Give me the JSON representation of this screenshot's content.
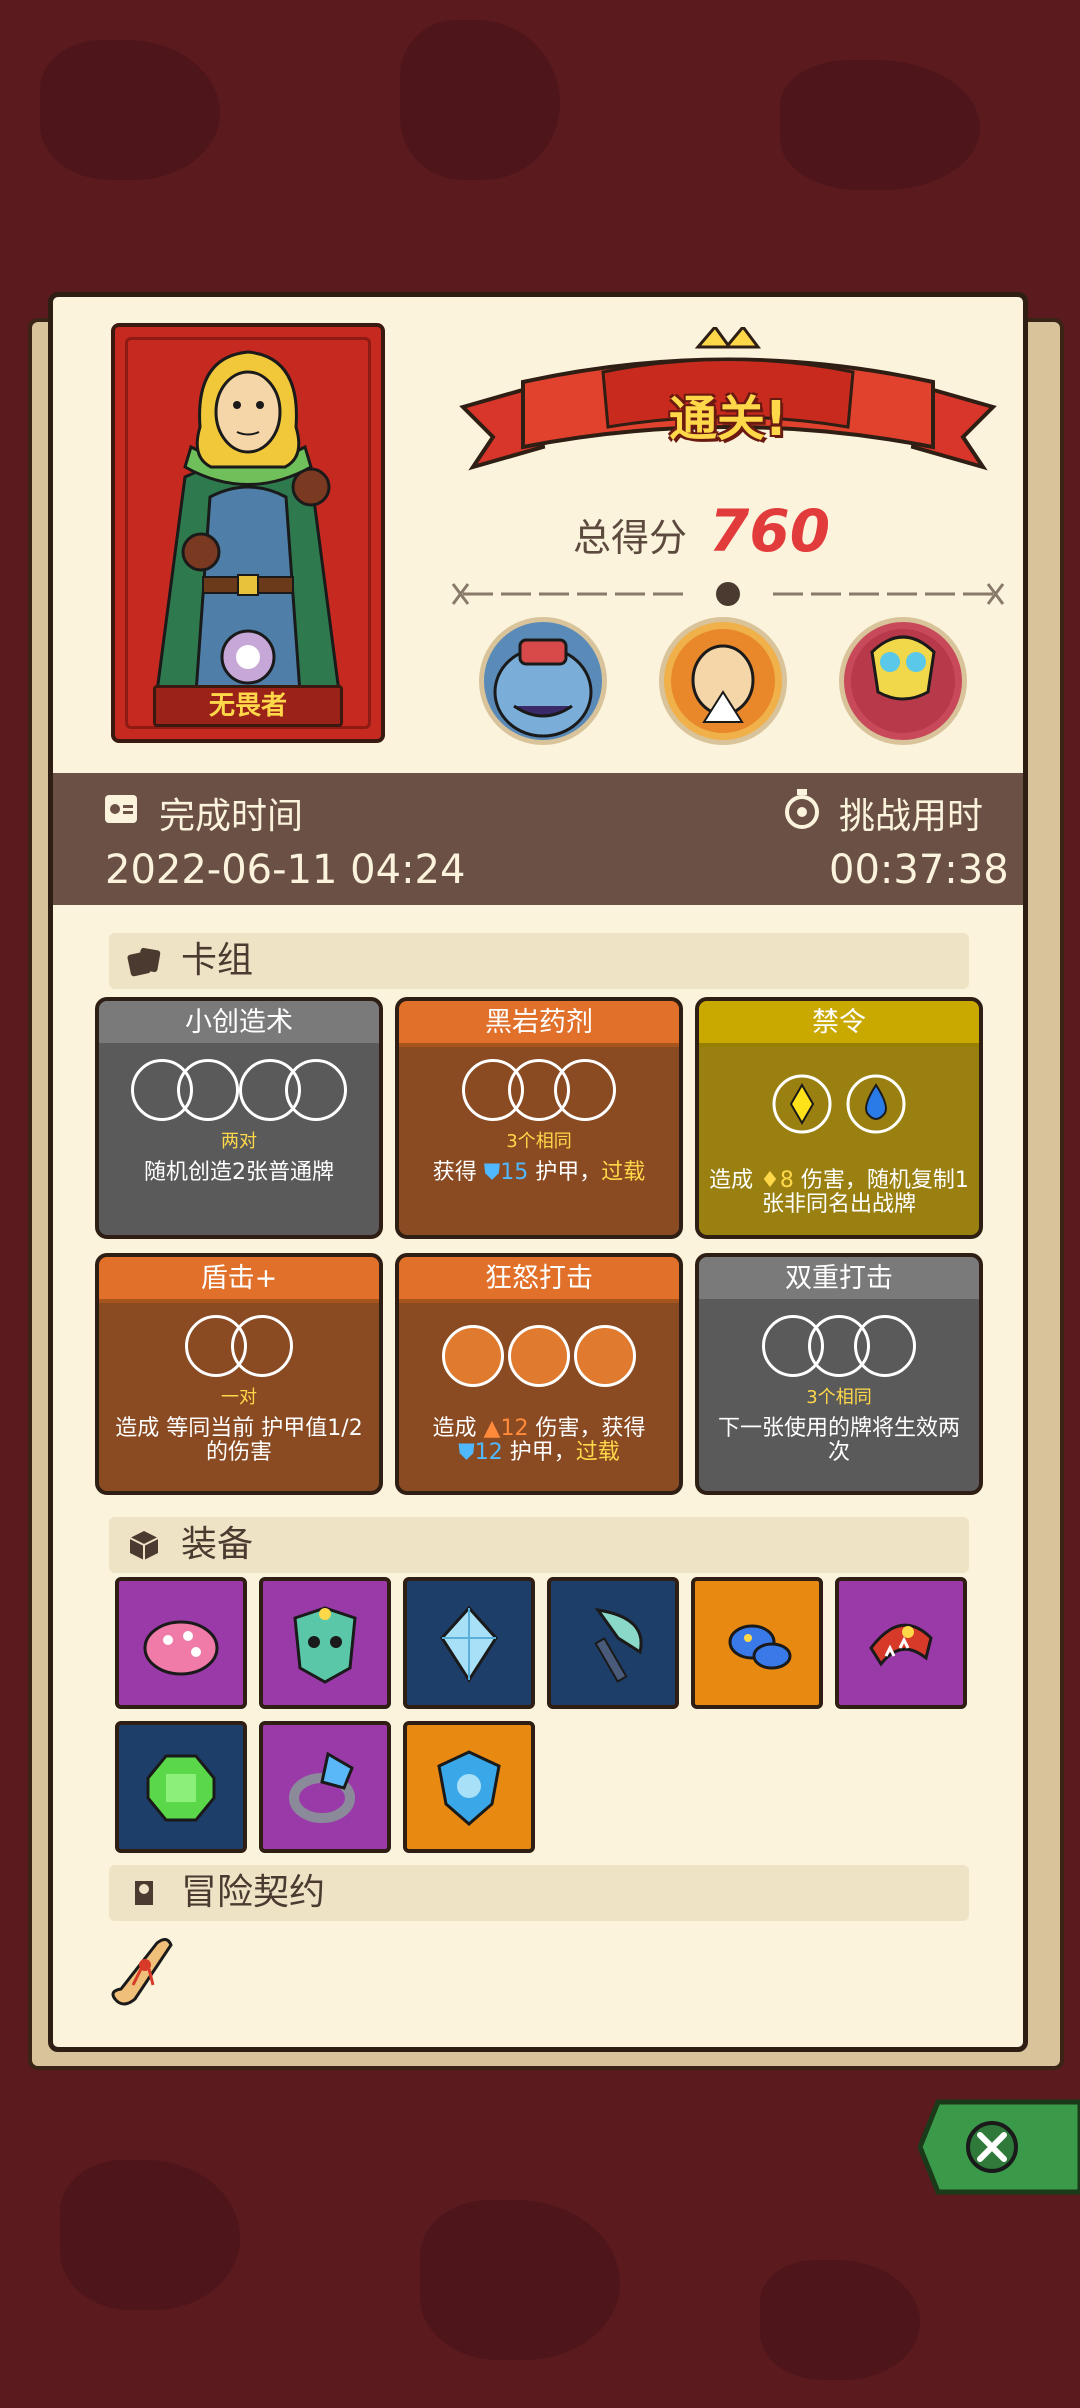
{
  "result": {
    "banner": "通关!",
    "score_label": "总得分",
    "score_value": "760"
  },
  "hero": {
    "name": "无畏者"
  },
  "time": {
    "complete_label": "完成时间",
    "complete_value": "2022-06-11 04:24",
    "challenge_label": "挑战用时",
    "challenge_value": "00:37:38"
  },
  "deck": {
    "header": "卡组",
    "cards": [
      {
        "title": "小创造术",
        "condition": "两对",
        "desc": "随机创造2张普通牌",
        "color": "gray"
      },
      {
        "title": "黑岩药剂",
        "condition": "3个相同",
        "desc_a": "获得 ",
        "num": "15",
        "desc_b": " 护甲，",
        "tag": "过载",
        "color": "brown"
      },
      {
        "title": "禁令",
        "desc_a": "造成 ",
        "num": "8",
        "desc_b": " 伤害，随机复制1张非同名出战牌",
        "color": "olive"
      },
      {
        "title": "盾击+",
        "condition": "一对",
        "desc": "造成 等同当前 护甲值1/2的伤害",
        "color": "brown"
      },
      {
        "title": "狂怒打击",
        "desc_a": "造成 ",
        "num1": "12",
        "desc_b": " 伤害，获得 ",
        "num2": "12",
        "desc_c": " 护甲，",
        "tag": "过载",
        "color": "brown"
      },
      {
        "title": "双重打击",
        "condition": "3个相同",
        "desc": "下一张使用的牌将生效两次",
        "color": "gray"
      }
    ]
  },
  "equipment": {
    "header": "装备",
    "items": [
      {
        "icon": "mushroom-icon",
        "bg": "purple"
      },
      {
        "icon": "demon-mask-icon",
        "bg": "purple"
      },
      {
        "icon": "crystal-gem-icon",
        "bg": "navy"
      },
      {
        "icon": "axe-icon",
        "bg": "navy"
      },
      {
        "icon": "blue-mushroom-icon",
        "bg": "orange"
      },
      {
        "icon": "monster-bracelet-icon",
        "bg": "purple"
      },
      {
        "icon": "emerald-icon",
        "bg": "navy"
      },
      {
        "icon": "diamond-ring-icon",
        "bg": "purple"
      },
      {
        "icon": "shield-charm-icon",
        "bg": "orange"
      }
    ]
  },
  "contract": {
    "header": "冒险契约"
  },
  "colors": {
    "paper": "#fbf3dc",
    "score": "#e23b3b",
    "accent_yellow": "#ffd84a"
  }
}
